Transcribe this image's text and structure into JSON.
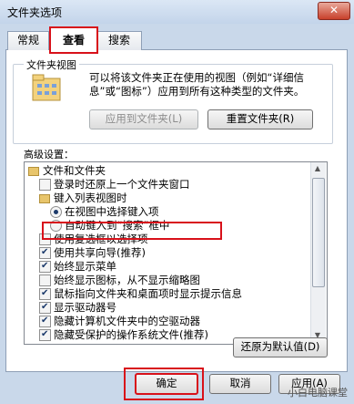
{
  "window": {
    "title": "文件夹选项",
    "close_glyph": "✕"
  },
  "tabs": [
    "常规",
    "查看",
    "搜索"
  ],
  "folder_view": {
    "group_label": "文件夹视图",
    "description": [
      "可以将该文件夹正在使用的视图（例如“详细信",
      "息”或“图标”）应用到所有这种类型的文件夹。"
    ],
    "apply_button": "应用到文件夹(L)",
    "reset_button": "重置文件夹(R)"
  },
  "advanced": {
    "label": "高级设置：",
    "items": [
      {
        "type": "folder",
        "indent": 0,
        "label": "文件和文件夹"
      },
      {
        "type": "checkbox",
        "indent": 1,
        "checked": false,
        "label": "登录时还原上一个文件夹窗口"
      },
      {
        "type": "folder",
        "indent": 1,
        "label": "键入列表视图时"
      },
      {
        "type": "radio",
        "indent": 2,
        "checked": true,
        "label": "在视图中选择键入项"
      },
      {
        "type": "radio",
        "indent": 2,
        "checked": false,
        "label": "自动键入到“搜索”框中"
      },
      {
        "type": "checkbox",
        "indent": 1,
        "checked": false,
        "label": "使用复选框以选择项"
      },
      {
        "type": "checkbox",
        "indent": 1,
        "checked": true,
        "label": "使用共享向导(推荐)"
      },
      {
        "type": "checkbox",
        "indent": 1,
        "checked": true,
        "label": "始终显示菜单"
      },
      {
        "type": "checkbox",
        "indent": 1,
        "checked": false,
        "label": "始终显示图标，从不显示缩略图"
      },
      {
        "type": "checkbox",
        "indent": 1,
        "checked": true,
        "label": "鼠标指向文件夹和桌面项时显示提示信息"
      },
      {
        "type": "checkbox",
        "indent": 1,
        "checked": true,
        "label": "显示驱动器号"
      },
      {
        "type": "checkbox",
        "indent": 1,
        "checked": true,
        "label": "隐藏计算机文件夹中的空驱动器"
      },
      {
        "type": "checkbox",
        "indent": 1,
        "checked": true,
        "label": "隐藏受保护的操作系统文件(推荐)"
      }
    ],
    "restore_button": "还原为默认值(D)"
  },
  "footer": {
    "ok": "确定",
    "cancel": "取消",
    "apply": "应用(A)"
  },
  "watermark": "小白电脑课堂"
}
